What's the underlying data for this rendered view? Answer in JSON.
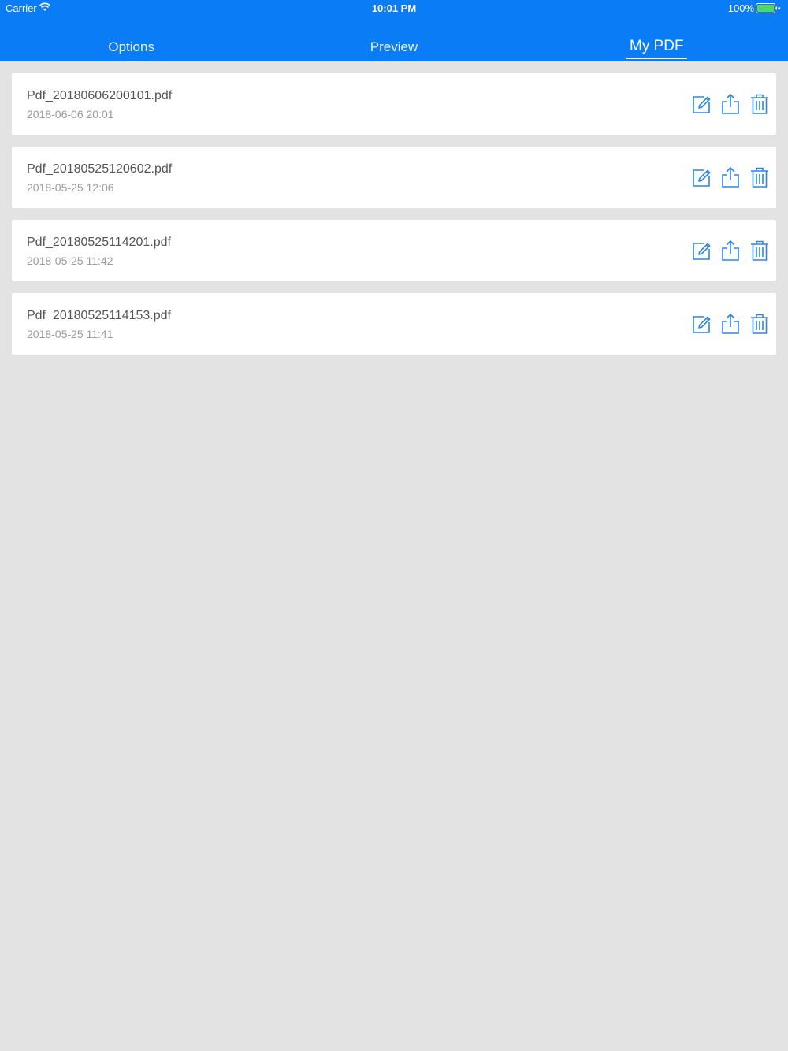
{
  "status": {
    "carrier": "Carrier",
    "time": "10:01 PM",
    "battery": "100%"
  },
  "tabs": [
    {
      "label": "Options",
      "active": false
    },
    {
      "label": "Preview",
      "active": false
    },
    {
      "label": "My PDF",
      "active": true
    }
  ],
  "files": [
    {
      "name": "Pdf_20180606200101.pdf",
      "date": "2018-06-06 20:01"
    },
    {
      "name": "Pdf_20180525120602.pdf",
      "date": "2018-05-25 12:06"
    },
    {
      "name": "Pdf_20180525114201.pdf",
      "date": "2018-05-25 11:42"
    },
    {
      "name": "Pdf_20180525114153.pdf",
      "date": "2018-05-25 11:41"
    }
  ],
  "colors": {
    "accent": "#0a7cf6",
    "icon": "#2a86e6",
    "background": "#e3e3e3",
    "battery_fill": "#4cd964"
  },
  "icons": {
    "edit": "edit-icon",
    "share": "share-icon",
    "delete": "trash-icon"
  }
}
